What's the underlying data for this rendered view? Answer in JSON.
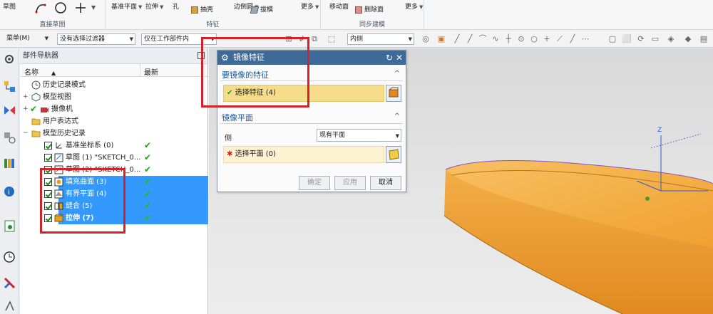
{
  "ribbon": {
    "sketch": "草图",
    "direct_sketch_group": "直接草图",
    "datum_plane": "基准平面",
    "extrude": "拉伸",
    "hole": "孔",
    "shell": "抽壳",
    "edge_blend": "边倒圆",
    "draft": "拔模",
    "more1": "更多",
    "feature_group": "特征",
    "move_face": "移动面",
    "delete_face": "删除面",
    "more2": "更多",
    "sync_group": "同步建模"
  },
  "toolbar": {
    "menu": "菜单(M)",
    "filter": "没有选择过滤器",
    "scope": "仅在工作部件内",
    "snap": "内侧"
  },
  "navigator": {
    "title": "部件导航器",
    "col_name": "名称",
    "col_latest": "最新",
    "rows": [
      {
        "label": "历史记录模式"
      },
      {
        "label": "模型视图"
      },
      {
        "label": "摄像机"
      },
      {
        "label": "用户表达式"
      },
      {
        "label": "模型历史记录"
      },
      {
        "label": "基准坐标系 (0)"
      },
      {
        "label": "草图 (1) \"SKETCH_0..."
      },
      {
        "label": "草图 (2) \"SKETCH_0..."
      },
      {
        "label": "填充曲面 (3)"
      },
      {
        "label": "有界平面 (4)"
      },
      {
        "label": "缝合 (5)"
      },
      {
        "label": "拉伸 (7)"
      }
    ]
  },
  "dialog": {
    "title": "镜像特征",
    "section1": "要镜像的特征",
    "select_feature": "选择特征 (4)",
    "section2": "镜像平面",
    "side_label": "侧",
    "side_value": "现有平面",
    "select_plane": "选择平面 (0)",
    "btn_ok": "确定",
    "btn_apply": "应用",
    "btn_cancel": "取消"
  },
  "viewport": {
    "axis_label": "Z"
  },
  "colors": {
    "selection": "#3399ff",
    "dialog_title": "#3e6a98",
    "highlight_box": "#d2232a",
    "part_body": "#f2a43a"
  }
}
